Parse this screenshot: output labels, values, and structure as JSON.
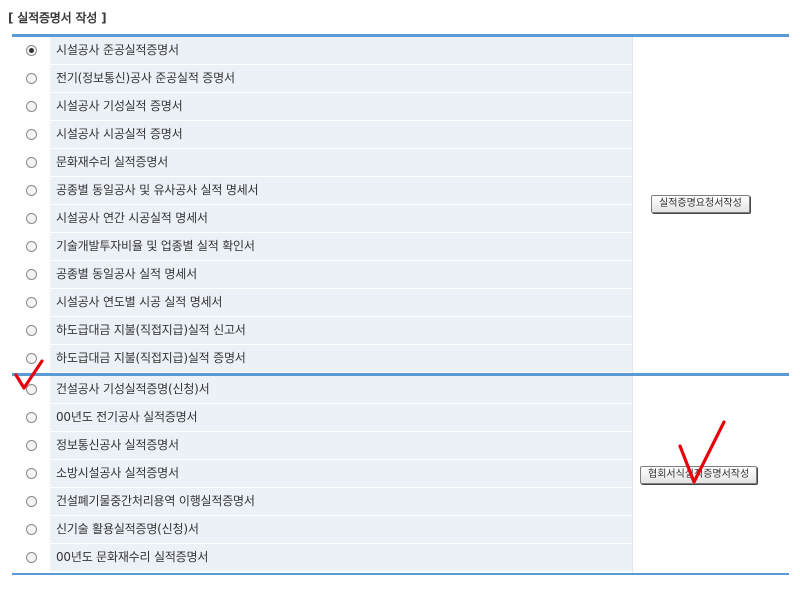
{
  "page": {
    "title": "[ 실적증명서 작성 ]"
  },
  "section1": {
    "items": [
      {
        "label": "시설공사 준공실적증명서",
        "checked": true
      },
      {
        "label": "전기(정보통신)공사 준공실적 증명서",
        "checked": false
      },
      {
        "label": "시설공사 기성실적 증명서",
        "checked": false
      },
      {
        "label": "시설공사 시공실적 증명서",
        "checked": false
      },
      {
        "label": "문화재수리 실적증명서",
        "checked": false
      },
      {
        "label": "공종별 동일공사 및 유사공사 실적 명세서",
        "checked": false
      },
      {
        "label": "시설공사 연간 시공실적 명세서",
        "checked": false
      },
      {
        "label": "기술개발투자비율 및 업종별 실적 확인서",
        "checked": false
      },
      {
        "label": "공종별 동일공사 실적 명세서",
        "checked": false
      },
      {
        "label": "시설공사 연도별 시공 실적 명세서",
        "checked": false
      },
      {
        "label": "하도급대금 지불(직접지급)실적 신고서",
        "checked": false
      },
      {
        "label": "하도급대금 지불(직접지급)실적 증명서",
        "checked": false
      }
    ],
    "button_label": "실적증명요청서작성"
  },
  "section2": {
    "items": [
      {
        "label": "건설공사 기성실적증명(신청)서",
        "checked": false
      },
      {
        "label": "00년도 전기공사 실적증명서",
        "checked": false
      },
      {
        "label": "정보통신공사 실적증명서",
        "checked": false
      },
      {
        "label": "소방시설공사 실적증명서",
        "checked": false
      },
      {
        "label": "건설폐기물중간처리용역 이행실적증명서",
        "checked": false
      },
      {
        "label": "신기술 활용실적증명(신청)서",
        "checked": false
      },
      {
        "label": "00년도 문화재수리 실적증명서",
        "checked": false
      }
    ],
    "button_label": "협회서식실적증명서작성"
  },
  "annotations": {
    "mark_color": "#e8000b"
  }
}
